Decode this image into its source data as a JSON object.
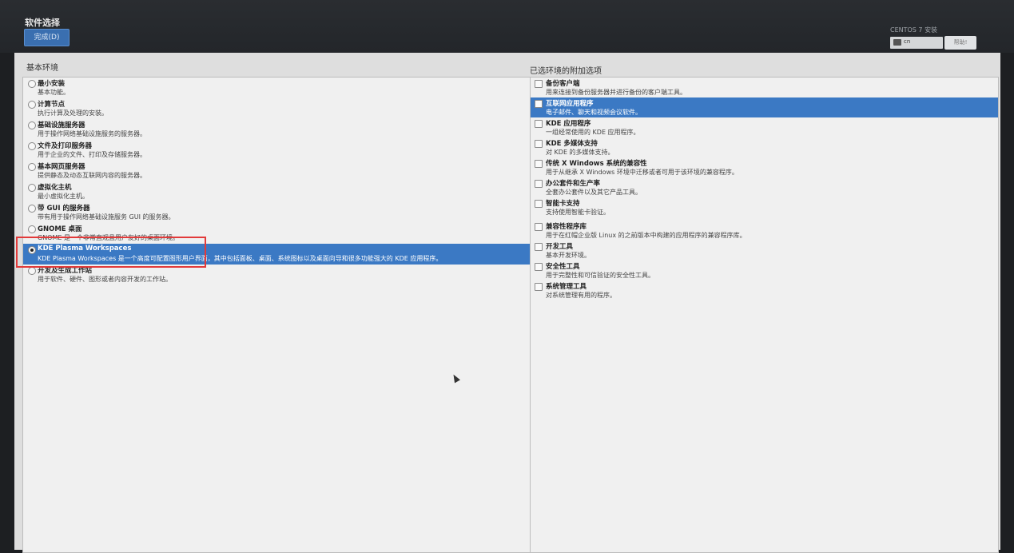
{
  "header": {
    "title": "软件选择",
    "done_button": "完成(D)",
    "product": "CENTOS 7 安装",
    "keyboard": "cn",
    "help": "帮助!"
  },
  "left": {
    "label": "基本环境",
    "items": [
      {
        "title": "最小安装",
        "desc": "基本功能。",
        "selected": false
      },
      {
        "title": "计算节点",
        "desc": "执行计算及处理的安装。",
        "selected": false
      },
      {
        "title": "基础设施服务器",
        "desc": "用于操作网络基础设施服务的服务器。",
        "selected": false
      },
      {
        "title": "文件及打印服务器",
        "desc": "用于企业的文件、打印及存储服务器。",
        "selected": false
      },
      {
        "title": "基本网页服务器",
        "desc": "提供静态及动态互联网内容的服务器。",
        "selected": false
      },
      {
        "title": "虚拟化主机",
        "desc": "最小虚拟化主机。",
        "selected": false
      },
      {
        "title": "带 GUI 的服务器",
        "desc": "带有用于操作网络基础设施服务 GUI 的服务器。",
        "selected": false
      },
      {
        "title": "GNOME 桌面",
        "desc": "GNOME 是一个非常直观且用户友好的桌面环境。",
        "selected": false
      },
      {
        "title": "KDE Plasma Workspaces",
        "desc": "KDE Plasma Workspaces 是一个高度可配置图形用户界面，其中包括面板、桌面、系统图标以及桌面向导和很多功能强大的 KDE 应用程序。",
        "selected": true
      },
      {
        "title": "开发及生成工作站",
        "desc": "用于软件、硬件、图形或者内容开发的工作站。",
        "selected": false
      }
    ]
  },
  "right": {
    "label": "已选环境的附加选项",
    "items": [
      {
        "title": "备份客户端",
        "desc": "用来连接到备份服务器并进行备份的客户端工具。",
        "selected": false
      },
      {
        "title": "互联网应用程序",
        "desc": "电子邮件、聊天和视频会议软件。",
        "selected": true
      },
      {
        "title": "KDE 应用程序",
        "desc": "一组经常使用的 KDE 应用程序。",
        "selected": false
      },
      {
        "title": "KDE 多媒体支持",
        "desc": "对 KDE 的多媒体支持。",
        "selected": false
      },
      {
        "title": "传统 X Windows 系统的兼容性",
        "desc": "用于从继承 X Windows 环境中迁移或者可用于该环境的兼容程序。",
        "selected": false
      },
      {
        "title": "办公套件和生产率",
        "desc": "全套办公套件以及其它产品工具。",
        "selected": false
      },
      {
        "title": "智能卡支持",
        "desc": "支持使用智能卡验证。",
        "selected": false
      },
      {
        "title": "兼容性程序库",
        "desc": "用于在红帽企业版 Linux 的之前版本中构建的应用程序的兼容程序库。",
        "selected": false
      },
      {
        "title": "开发工具",
        "desc": "基本开发环境。",
        "selected": false
      },
      {
        "title": "安全性工具",
        "desc": "用于完整性和可信验证的安全性工具。",
        "selected": false
      },
      {
        "title": "系统管理工具",
        "desc": "对系统管理有用的程序。",
        "selected": false
      }
    ]
  }
}
